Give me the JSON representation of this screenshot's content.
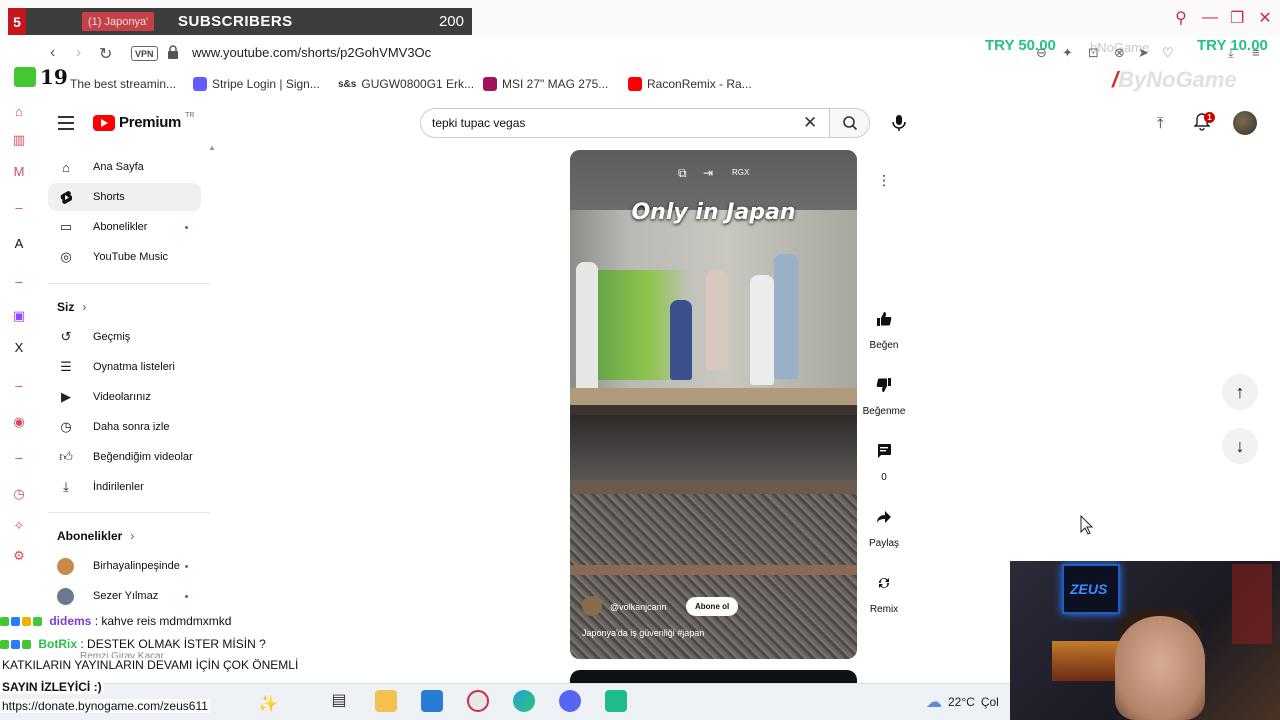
{
  "browser": {
    "overlay_number": "5",
    "tab_title": "(1) Japonya'",
    "subscribers_label": "SUBSCRIBERS",
    "subscribers_count": "200",
    "url": "www.youtube.com/shorts/p2GohVMV3Oc",
    "vpn_label": "VPN",
    "donation_left": "TRY 50.00",
    "donation_right": "TRY 10.00",
    "ghost_name": "bNoGame",
    "live_count": "19",
    "brand_watermark": "ByNoGame",
    "bookmarks": [
      {
        "label": "The best streamin...",
        "color": "#34a853"
      },
      {
        "label": "Stripe Login | Sign...",
        "color": "#635bff"
      },
      {
        "label": "GUGW0800G1 Erk...",
        "color": "#444444"
      },
      {
        "label": "MSI 27\" MAG 275...",
        "color": "#a1125c"
      },
      {
        "label": "RaconRemix - Ra...",
        "color": "#ff0000"
      }
    ]
  },
  "youtube": {
    "logo_text": "Premium",
    "logo_region": "TR",
    "search_value": "tepki tupac vegas",
    "notification_count": "1",
    "sidebar": {
      "main": [
        {
          "label": "Ana Sayfa",
          "icon": "home-icon"
        },
        {
          "label": "Shorts",
          "icon": "shorts-icon",
          "active": true
        },
        {
          "label": "Abonelikler",
          "icon": "subscriptions-icon",
          "dot": true
        },
        {
          "label": "YouTube Music",
          "icon": "music-icon"
        }
      ],
      "you_heading": "Siz",
      "you": [
        {
          "label": "Geçmiş",
          "icon": "history-icon"
        },
        {
          "label": "Oynatma listeleri",
          "icon": "playlist-icon"
        },
        {
          "label": "Videolarınız",
          "icon": "your-videos-icon"
        },
        {
          "label": "Daha sonra izle",
          "icon": "watch-later-icon"
        },
        {
          "label": "Beğendiğim videolar",
          "icon": "liked-icon"
        },
        {
          "label": "İndirilenler",
          "icon": "download-icon"
        }
      ],
      "subs_heading": "Abonelikler",
      "subs": [
        {
          "label": "Birhayalinpeşinde",
          "color": "#c98a4a",
          "dot": true
        },
        {
          "label": "Sezer Yılmaz",
          "color": "#6b7a8c",
          "dot": true
        }
      ],
      "hidden_sub": "Remzi Giray Kacar"
    },
    "short": {
      "title": "Only in Japan",
      "handle": "@volkanjcann",
      "subscribe_label": "Abone ol",
      "caption": "Japonya'da iş güvenliği #japan",
      "topic_badge": "RGX"
    },
    "actions": {
      "like": "Beğen",
      "dislike": "Beğenme",
      "comments": "0",
      "share": "Paylaş",
      "remix": "Remix"
    }
  },
  "stream_overlay": {
    "chat": [
      {
        "user": "didems",
        "sep": " : ",
        "text": "kahve reis mdmdmxmkd"
      },
      {
        "user": "BotRix",
        "sep": " : ",
        "text": "DESTEK OLMAK İSTER MİSİN ?"
      },
      {
        "user": "",
        "sep": "",
        "text": "KATKILARIN YAYINLARIN DEVAMI İÇİN ÇOK ÖNEMLİ"
      }
    ],
    "sayin": "SAYIN İZLEYİCİ :)",
    "donate_url": "https://donate.bynogame.com/zeus611",
    "cam_text": "ZEUS"
  },
  "taskbar": {
    "temperature": "22°C",
    "weather_text": "Çol"
  },
  "colors": {
    "yt_red": "#ff0000",
    "donation_green": "#26c281",
    "active_bg": "#f0f0f0"
  }
}
